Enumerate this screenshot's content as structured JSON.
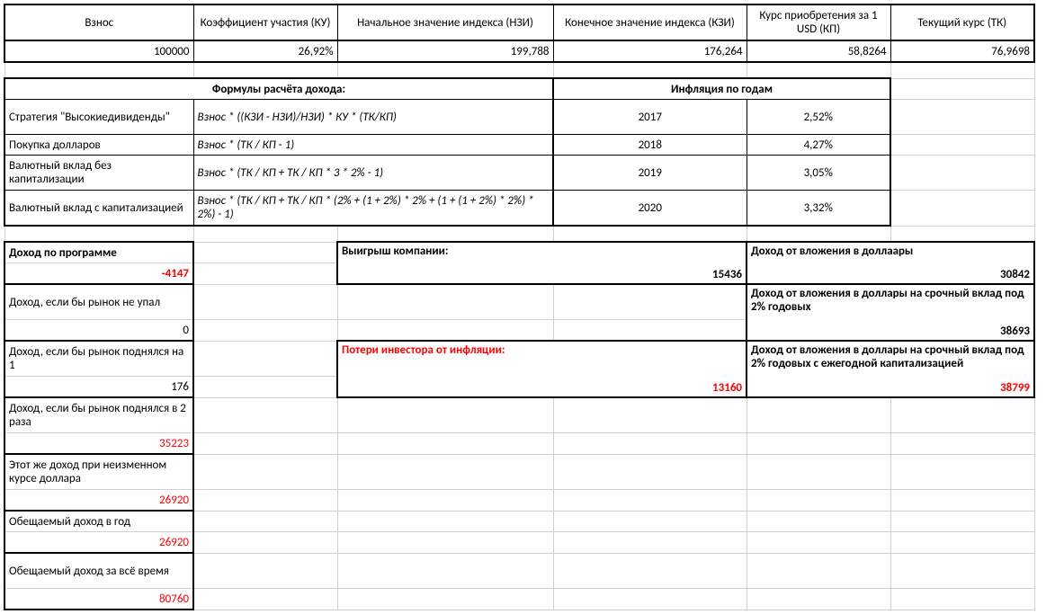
{
  "headers": {
    "c1": "Взнос",
    "c2": "Коэффициент участия (КУ)",
    "c3": "Начальное значение индекса (НЗИ)",
    "c4": "Конечное значение индекса (КЗИ)",
    "c5": "Курс приобретения за 1 USD (КП)",
    "c6": "Текущий курс (ТК)"
  },
  "inputs": {
    "c1": "100000",
    "c2": "26,92%",
    "c3": "199,788",
    "c4": "176,264",
    "c5": "58,8264",
    "c6": "76,9698"
  },
  "sectionTitles": {
    "formulas": "Формулы расчёта дохода:",
    "inflation": "Инфляция по годам"
  },
  "formulas": {
    "r1": {
      "label": "Стратегия \"Высокиедивиденды\"",
      "formula": "Взнос * ((КЗИ - НЗИ)/НЗИ) * КУ * (ТК/КП)",
      "year": "2017",
      "infl": "2,52%"
    },
    "r2": {
      "label": "Покупка долларов",
      "formula": "Взнос * (ТК / КП - 1)",
      "year": "2018",
      "infl": "4,27%"
    },
    "r3": {
      "label": "Валютный вклад без капитализации",
      "formula": "Взнос * (ТК / КП + ТК / КП * 3 * 2% - 1)",
      "year": "2019",
      "infl": "3,05%"
    },
    "r4": {
      "label": "Валютный вклад с капитализацией",
      "formula": "Взнос * (ТК / КП + ТК / КП * (2% + (1 + 2%) * 2% + (1 + (1 + 2%) * 2%) * 2%) - 1)",
      "year": "2020",
      "infl": "3,32%"
    }
  },
  "left": {
    "r1": {
      "label": "Доход по программе",
      "value": "-4147"
    },
    "r2": {
      "label": "Доход, если бы рынок не упал",
      "value": "0"
    },
    "r3": {
      "label": "Доход, если бы рынок поднялся на 1",
      "value": "176"
    },
    "r4": {
      "label": "Доход, если бы рынок поднялся в 2 раза",
      "value": "35223"
    },
    "r5": {
      "label": "Этот же доход при неизменном курсе доллара",
      "value": "26920"
    },
    "r6": {
      "label": "Обещаемый доход в год",
      "value": "26920"
    },
    "r7": {
      "label": "Обещаемый доход за всё время",
      "value": "80760"
    }
  },
  "mid": {
    "win": {
      "label": "Выигрыш компании:",
      "value": "15436"
    },
    "loss": {
      "label": "Потери инвестора от инфляции:",
      "value": "13160"
    }
  },
  "right": {
    "r1": {
      "label": "Доход от вложения в доллаары",
      "value": "30842"
    },
    "r2": {
      "label": "Доход от вложения в доллары на срочный вклад под 2% годовых",
      "value": "38693"
    },
    "r3": {
      "label": "Доход от вложения в доллары на срочный вклад под 2% годовых с ежегодной капитализацией",
      "value": "38799"
    }
  }
}
